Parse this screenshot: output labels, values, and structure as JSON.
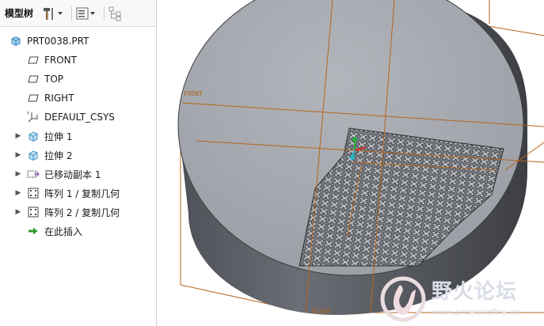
{
  "toolbar": {
    "title": "模型树"
  },
  "tree": {
    "items": [
      {
        "label": "PRT0038.PRT",
        "icon": "part-icon",
        "expandable": false
      },
      {
        "label": "FRONT",
        "icon": "datum-plane-icon",
        "expandable": false
      },
      {
        "label": "TOP",
        "icon": "datum-plane-icon",
        "expandable": false
      },
      {
        "label": "RIGHT",
        "icon": "datum-plane-icon",
        "expandable": false
      },
      {
        "label": "DEFAULT_CSYS",
        "icon": "csys-icon",
        "expandable": false
      },
      {
        "label": "拉伸 1",
        "icon": "extrude-icon",
        "expandable": true
      },
      {
        "label": "拉伸 2",
        "icon": "extrude-icon",
        "expandable": true
      },
      {
        "label": "已移动副本 1",
        "icon": "moved-copy-icon",
        "expandable": true
      },
      {
        "label": "阵列 1 / 复制几何",
        "icon": "pattern-icon",
        "expandable": true
      },
      {
        "label": "阵列 2 / 复制几何",
        "icon": "pattern-icon",
        "expandable": true
      },
      {
        "label": "在此插入",
        "icon": "insert-here-icon",
        "expandable": false
      }
    ]
  },
  "viewport": {
    "labels": {
      "front": "FRONT",
      "right": "RIGHT"
    }
  },
  "watermark": {
    "text": "野火论坛",
    "url": "www.proewildfire.cn"
  },
  "colors": {
    "datum": "#b5651d",
    "body_top": "#a9acb2",
    "body_side": "#5e6168",
    "grid": "#3c3f45"
  }
}
